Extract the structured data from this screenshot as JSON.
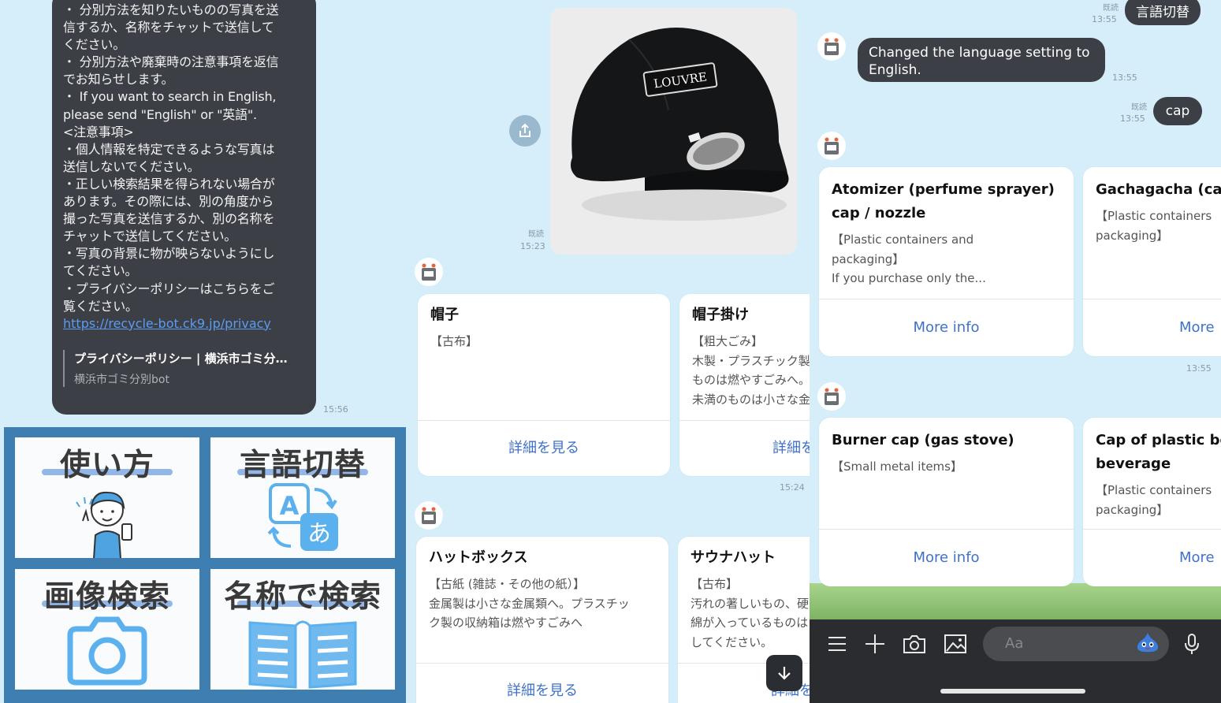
{
  "panel1": {
    "bubble_text": "・ 分別方法を知りたいものの写真を送\n信するか、名称をチャットで送信して\nください。\n・ 分別方法や廃棄時の注意事項を返信\nでお知らせします。\n・ If you want to search in English,\nplease send \"English\" or \"英語\".\n<注意事項>\n・個人情報を特定できるような写真は\n送信しないでください。\n・正しい検索結果を得られない場合が\nあります。その際には、別の角度から\n撮った写真を送信するか、別の名称を\nチャットで送信してください。\n・写真の背景に物が映らないようにし\nてください。\n・プライバシーポリシーはこちらをご\n覧ください。",
    "link": "https://recycle-bot.ck9.jp/privacy",
    "preview_title": "プライバシーポリシー | 横浜市ゴミ分…",
    "preview_site": "横浜市ゴミ分別bot",
    "time": "15:56",
    "rich_menu": [
      {
        "label": "使い方",
        "icon": "person-phone-illustration"
      },
      {
        "label": "言語切替",
        "icon": "translate-icon"
      },
      {
        "label": "画像検索",
        "icon": "camera-icon"
      },
      {
        "label": "名称で検索",
        "icon": "book-icon"
      }
    ]
  },
  "panel2": {
    "photo_logo": "LOUVRE",
    "read": "既読",
    "read_time": "15:23",
    "cards_row1": [
      {
        "title": "帽子",
        "desc": "【古布】",
        "button": "詳細を見る"
      },
      {
        "title": "帽子掛け",
        "desc": "【粗大ごみ】\n木製・プラスチック製\nものは燃やすごみへ。\n未満のものは小さな金",
        "button": "詳細を"
      }
    ],
    "time_row1": "15:24",
    "cards_row2": [
      {
        "title": "ハットボックス",
        "desc": "【古紙 (雑誌・その他の紙）】\n金属製は小さな金属類へ。プラスチッ\nク製の収納箱は燃やすごみへ",
        "button": "詳細を見る"
      },
      {
        "title": "サウナハット",
        "desc": "【古布】\n汚れの著しいもの、硬\n綿が入っているものは\nしてください。",
        "button": "詳細を"
      }
    ]
  },
  "panel3": {
    "top_read": "既読",
    "top_time": "13:55",
    "top_bubble": "言語切替",
    "bot_msg": "Changed the language setting to\nEnglish.",
    "bot_time": "13:55",
    "user_read": "既読",
    "user_time": "13:55",
    "user_msg": "cap",
    "cards_row1": [
      {
        "title": "Atomizer (perfume sprayer)\ncap / nozzle",
        "desc": "【Plastic containers and\npackaging】\nIf you purchase only the...",
        "button": "More info"
      },
      {
        "title": "Gachagacha (ca",
        "desc": "【Plastic containers\npackaging】",
        "button": "More"
      }
    ],
    "time_row1": "13:55",
    "cards_row2": [
      {
        "title": "Burner cap (gas stove)",
        "desc": "【Small metal items】",
        "button": "More info"
      },
      {
        "title": "Cap of plastic bo\nbeverage",
        "desc": "【Plastic containers\npackaging】",
        "button": "More"
      }
    ],
    "input_placeholder": "Aa"
  },
  "colors": {
    "chat_bg": "#d5eefa",
    "bubble_dark": "#3c3f45",
    "menu_bg": "#3f7eb1",
    "link_blue": "#3f72c9"
  }
}
